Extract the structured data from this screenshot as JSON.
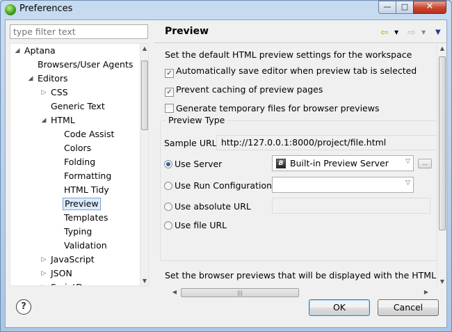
{
  "window": {
    "title": "Preferences",
    "close_glyph": "✕",
    "min_glyph": "—",
    "max_glyph": "□"
  },
  "filter": {
    "placeholder": "type filter text"
  },
  "tree": {
    "items": [
      {
        "label": "Aptana",
        "expander": "expanded"
      },
      {
        "label": "Browsers/User Agents",
        "expander": "none"
      },
      {
        "label": "Editors",
        "expander": "expanded"
      },
      {
        "label": "CSS",
        "expander": "collapsed"
      },
      {
        "label": "Generic Text",
        "expander": "none"
      },
      {
        "label": "HTML",
        "expander": "expanded"
      },
      {
        "label": "Code Assist",
        "expander": "none"
      },
      {
        "label": "Colors",
        "expander": "none"
      },
      {
        "label": "Folding",
        "expander": "none"
      },
      {
        "label": "Formatting",
        "expander": "none"
      },
      {
        "label": "HTML Tidy",
        "expander": "none"
      },
      {
        "label": "Preview",
        "expander": "none",
        "selected": true
      },
      {
        "label": "Templates",
        "expander": "none"
      },
      {
        "label": "Typing",
        "expander": "none"
      },
      {
        "label": "Validation",
        "expander": "none"
      },
      {
        "label": "JavaScript",
        "expander": "collapsed"
      },
      {
        "label": "JSON",
        "expander": "collapsed"
      },
      {
        "label": "ScriptDoc",
        "expander": "collapsed"
      }
    ]
  },
  "page": {
    "title": "Preview",
    "description": "Set the default HTML preview settings for the workspace",
    "checkboxes": [
      {
        "label": "Automatically save editor when preview tab is selected",
        "checked": true
      },
      {
        "label": "Prevent caching of preview pages",
        "checked": true
      },
      {
        "label": "Generate temporary files for browser previews",
        "checked": false
      }
    ],
    "preview_type": {
      "group_title": "Preview Type",
      "sample_url_label": "Sample URL:",
      "sample_url_value": "http://127.0.0.1:8000/project/file.html",
      "options": [
        {
          "label": "Use Server",
          "selected": true
        },
        {
          "label": "Use Run Configuration",
          "selected": false
        },
        {
          "label": "Use absolute URL",
          "selected": false
        },
        {
          "label": "Use file URL",
          "selected": false
        }
      ],
      "server_combo_value": "Built-in Preview Server",
      "server_icon_letter": "B"
    },
    "browser_desc": "Set the browser previews that will be displayed with the HTML edit"
  },
  "buttons": {
    "ok": "OK",
    "cancel": "Cancel",
    "help": "?"
  },
  "colors": {
    "accent": "#3c7fb1",
    "selection_bg": "#dcebfc",
    "dialog_bg": "#f0f0f0"
  }
}
